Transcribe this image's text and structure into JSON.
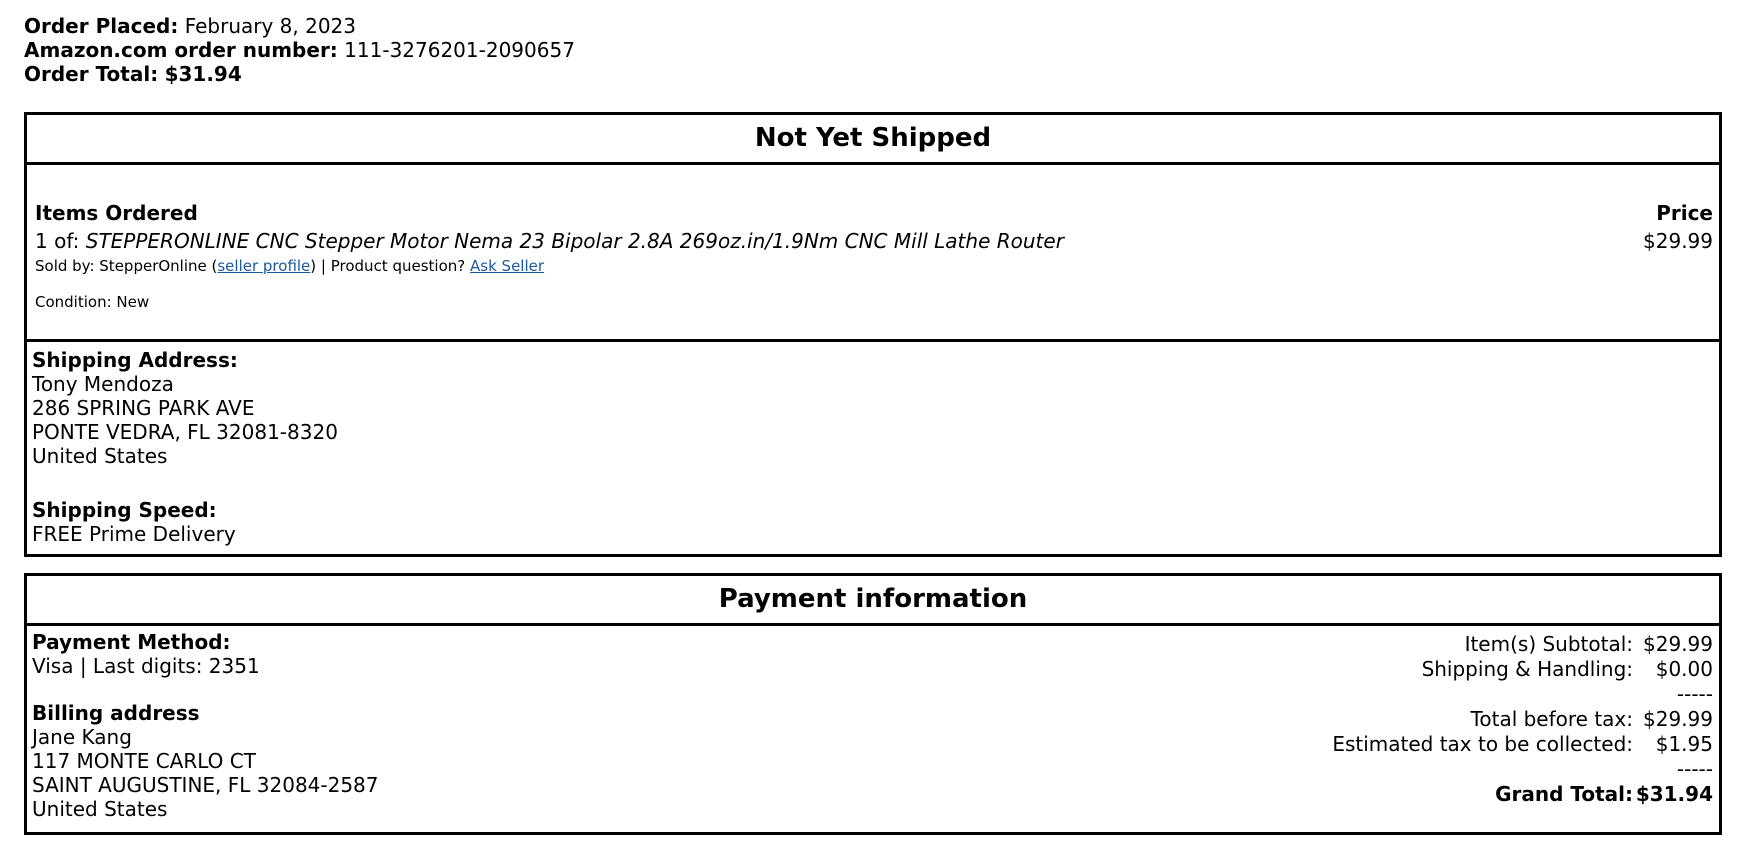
{
  "order": {
    "placed_label": "Order Placed:",
    "placed_value": "February 8, 2023",
    "number_label": "Amazon.com order number:",
    "number_value": "111-3276201-2090657",
    "total_label": "Order Total:",
    "total_value": "$31.94"
  },
  "shipment": {
    "header": "Not Yet Shipped",
    "items_heading": "Items Ordered",
    "price_heading": "Price",
    "item": {
      "quantity_prefix": "1 of:",
      "title": "STEPPERONLINE CNC Stepper Motor Nema 23 Bipolar 2.8A 269oz.in/1.9Nm CNC Mill Lathe Router",
      "price": "$29.99",
      "sold_by_prefix": "Sold by: StepperOnline (",
      "seller_profile_link": "seller profile",
      "sold_by_suffix": ") | Product question?",
      "ask_seller_link": "Ask Seller",
      "condition": "Condition: New"
    },
    "shipping_address_label": "Shipping Address:",
    "shipping_address": {
      "name": "Tony Mendoza",
      "street": "286 SPRING PARK AVE",
      "city_state_zip": "PONTE VEDRA, FL 32081-8320",
      "country": "United States"
    },
    "shipping_speed_label": "Shipping Speed:",
    "shipping_speed": "FREE Prime Delivery"
  },
  "payment": {
    "header": "Payment information",
    "method_label": "Payment Method:",
    "method_value": "Visa | Last digits: 2351",
    "billing_label": "Billing address",
    "billing_address": {
      "name": "Jane Kang",
      "street": "117 MONTE CARLO CT",
      "city_state_zip": "SAINT AUGUSTINE, FL 32084-2587",
      "country": "United States"
    },
    "totals": {
      "subtotal_label": "Item(s) Subtotal:",
      "subtotal_value": "$29.99",
      "shipping_label": "Shipping & Handling:",
      "shipping_value": "$0.00",
      "separator": "-----",
      "before_tax_label": "Total before tax:",
      "before_tax_value": "$29.99",
      "tax_label": "Estimated tax to be collected:",
      "tax_value": "$1.95",
      "grand_label": "Grand Total:",
      "grand_value": "$31.94"
    }
  }
}
